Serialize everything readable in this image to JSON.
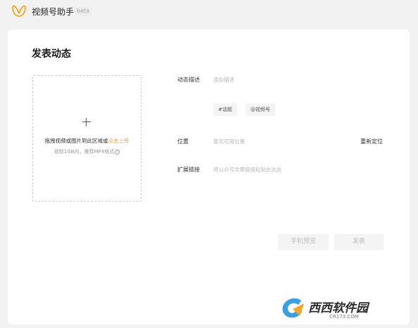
{
  "header": {
    "app_title": "视频号助手",
    "beta": "beta"
  },
  "page": {
    "title": "发表动态"
  },
  "upload": {
    "hint_main": "拖拽视频或图片到此区域或",
    "hint_link": "点击上传",
    "hint_sub": "视频1GB内，推荐MP4格式"
  },
  "form": {
    "description": {
      "label": "动态描述",
      "placeholder": "添加描述"
    },
    "tags": [
      "#话题",
      "@视频号"
    ],
    "location": {
      "label": "位置",
      "placeholder": "暂无可用位置",
      "action": "重新定位"
    },
    "extended_link": {
      "label": "扩展链接",
      "placeholder": "将公众号文章链接粘贴在此处"
    }
  },
  "actions": {
    "preview": "手机预览",
    "publish": "发表"
  },
  "watermark": {
    "text": "西西软件园",
    "sub": "CR173.COM"
  },
  "colors": {
    "accent": "#e8a33c",
    "card_bg": "#ffffff",
    "page_bg": "#f2f2f2",
    "button_bg": "#f4f4f4",
    "button_text": "#bdbdbd"
  }
}
